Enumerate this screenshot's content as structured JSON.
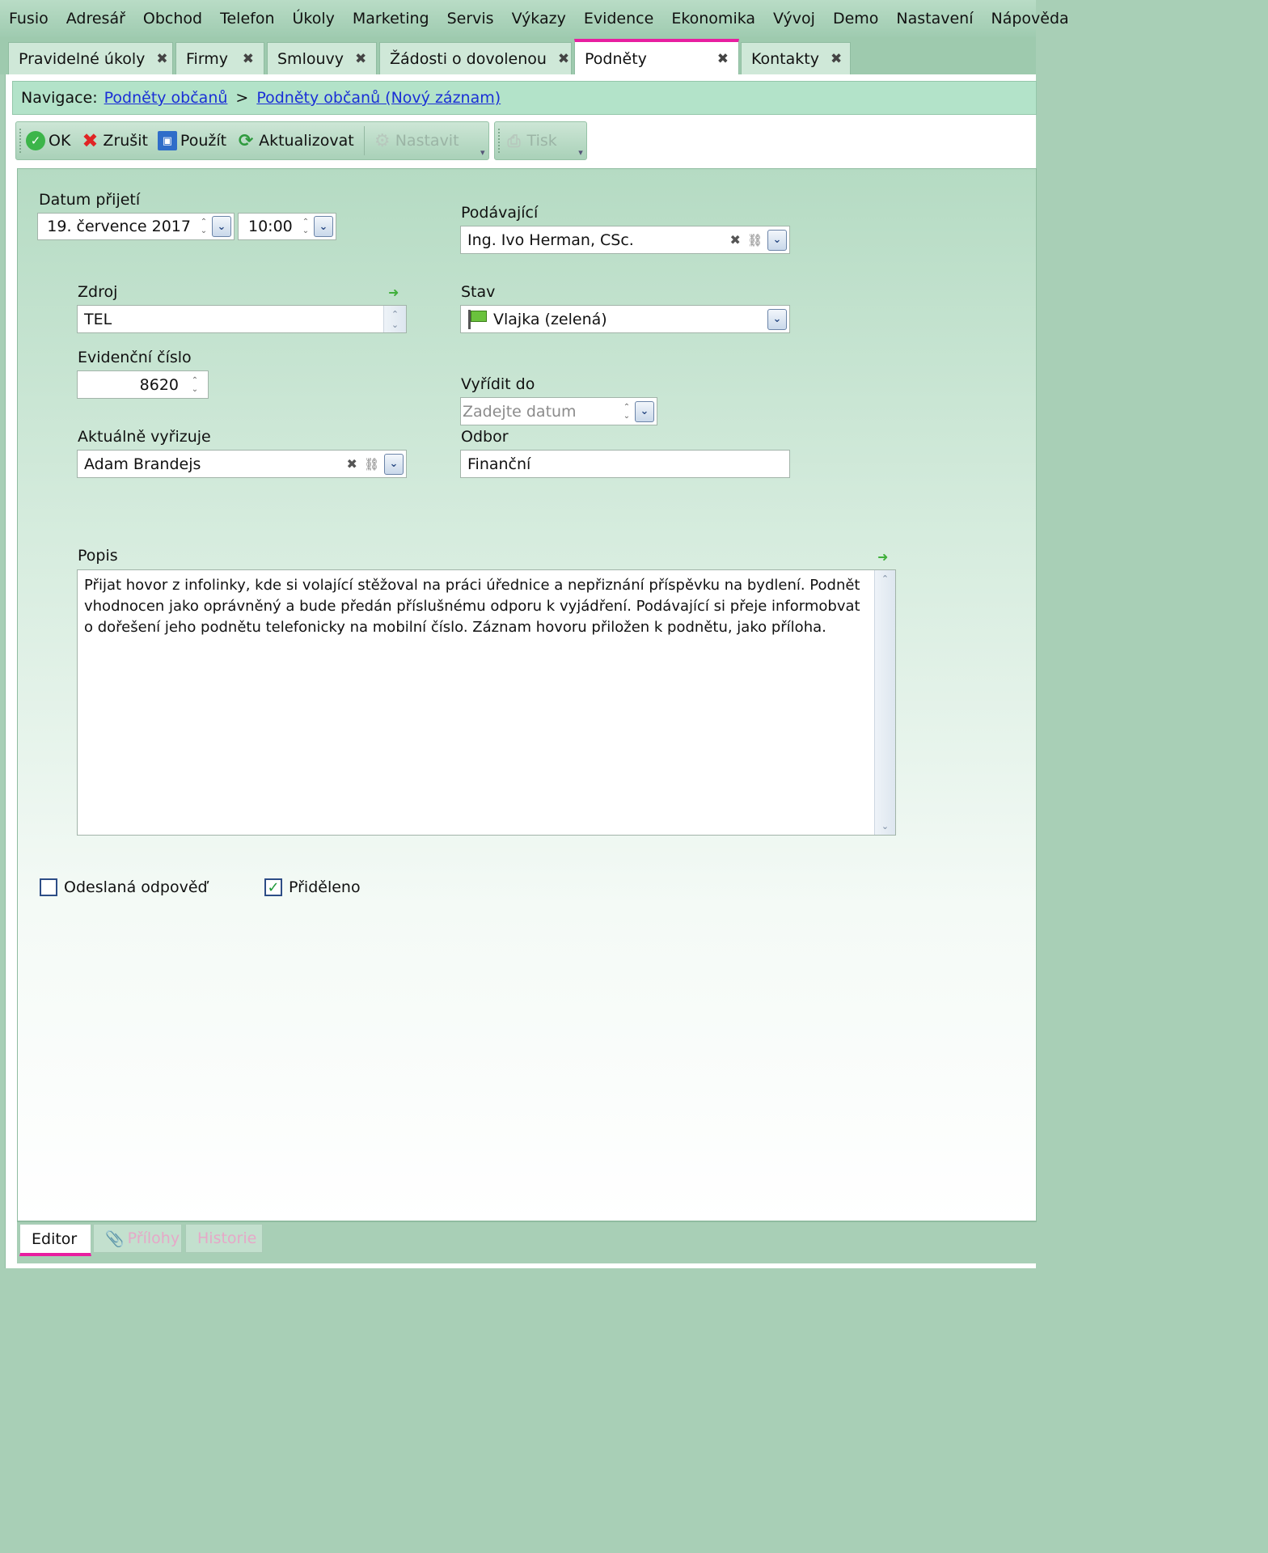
{
  "menu": [
    "Fusio",
    "Adresář",
    "Obchod",
    "Telefon",
    "Úkoly",
    "Marketing",
    "Servis",
    "Výkazy",
    "Evidence",
    "Ekonomika",
    "Vývoj",
    "Demo",
    "Nastavení",
    "Nápověda"
  ],
  "tabs": [
    {
      "label": "Pravidelné úkoly"
    },
    {
      "label": "Firmy"
    },
    {
      "label": "Smlouvy"
    },
    {
      "label": "Žádosti o dovolenou"
    },
    {
      "label": "Podněty"
    },
    {
      "label": "Kontakty"
    }
  ],
  "tab_close_glyph": "✖",
  "navigation": {
    "prefix": "Navigace:",
    "crumb1": "Podněty občanů",
    "separator": ">",
    "crumb2": "Podněty občanů (Nový záznam)"
  },
  "toolbar": {
    "ok": "OK",
    "cancel": "Zrušit",
    "apply": "Použít",
    "refresh": "Aktualizovat",
    "settings": "Nastavit",
    "print": "Tisk"
  },
  "form": {
    "received_date_label": "Datum přijetí",
    "received_date": "19. července 2017",
    "received_time": "10:00",
    "submitter_label": "Podávající",
    "submitter": "Ing. Ivo Herman, CSc.",
    "source_label": "Zdroj",
    "source": "TEL",
    "state_label": "Stav",
    "state": "Vlajka (zelená)",
    "evidence_no_label": "Evidenční číslo",
    "evidence_no": "8620",
    "resolve_by_label": "Vyřídit do",
    "resolve_by_placeholder": "Zadejte datum",
    "assignee_label": "Aktuálně vyřizuje",
    "assignee": "Adam Brandejs",
    "department_label": "Odbor",
    "department": "Finanční",
    "description_label": "Popis",
    "description": "Přijat hovor z infolinky, kde si volající stěžoval na práci úřednice a nepřiznání příspěvku na bydlení. Podnět vhodnocen jako oprávněný a bude předán příslušnému odporu k vyjádření. Podávající si přeje informobvat o dořešení jeho podnětu telefonicky na mobilní číslo. Záznam hovoru přiložen k podnětu, jako příloha.",
    "answer_sent_label": "Odeslaná odpověď",
    "answer_sent": false,
    "assigned_label": "Přiděleno",
    "assigned": true
  },
  "bottom_tabs": [
    "Editor",
    "Přílohy",
    "Historie"
  ],
  "colors": {
    "accent": "#e81ea0",
    "link": "#1a2fd6",
    "flag": "#6ac23d"
  },
  "icons": [
    "ok-icon",
    "cancel-icon",
    "save-icon",
    "refresh-icon",
    "gear-icon",
    "print-icon",
    "flag-icon",
    "arrow-right-icon",
    "paperclip-icon",
    "link-icon",
    "clear-icon",
    "chevron-down-icon"
  ]
}
